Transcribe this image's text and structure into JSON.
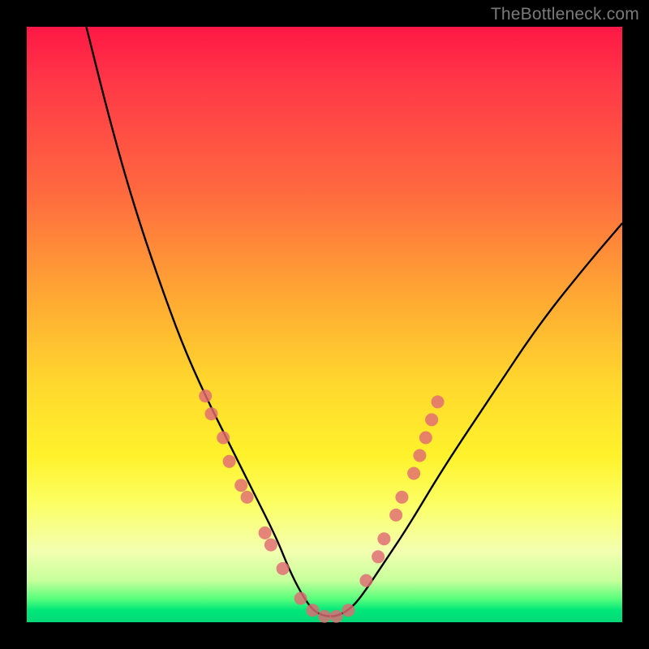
{
  "watermark": "TheBottleneck.com",
  "colors": {
    "frame": "#000000",
    "gradient_top": "#ff1846",
    "gradient_mid": "#ffd82d",
    "gradient_bottom": "#00d977",
    "curve": "#000000",
    "dot": "#e06a74"
  },
  "chart_data": {
    "type": "line",
    "title": "",
    "xlabel": "",
    "ylabel": "",
    "xlim": [
      0,
      100
    ],
    "ylim": [
      0,
      100
    ],
    "grid": false,
    "legend": false,
    "series": [
      {
        "name": "bottleneck-curve",
        "x": [
          10,
          14,
          18,
          22,
          26,
          30,
          34,
          38,
          42,
          44,
          46,
          48,
          50,
          52,
          54,
          56,
          60,
          64,
          70,
          78,
          86,
          94,
          100
        ],
        "y": [
          100,
          84,
          70,
          58,
          47,
          38,
          30,
          22,
          14,
          9,
          5,
          2,
          1,
          1,
          2,
          4,
          10,
          16,
          26,
          38,
          50,
          60,
          67
        ]
      }
    ],
    "markers": [
      {
        "name": "left-cluster",
        "x": 30,
        "y": 38
      },
      {
        "name": "left-cluster",
        "x": 31,
        "y": 35
      },
      {
        "name": "left-cluster",
        "x": 33,
        "y": 31
      },
      {
        "name": "left-cluster",
        "x": 34,
        "y": 27
      },
      {
        "name": "left-cluster",
        "x": 36,
        "y": 23
      },
      {
        "name": "left-cluster",
        "x": 37,
        "y": 21
      },
      {
        "name": "left-cluster",
        "x": 40,
        "y": 15
      },
      {
        "name": "left-cluster",
        "x": 41,
        "y": 13
      },
      {
        "name": "left-cluster",
        "x": 43,
        "y": 9
      },
      {
        "name": "valley",
        "x": 46,
        "y": 4
      },
      {
        "name": "valley",
        "x": 48,
        "y": 2
      },
      {
        "name": "valley",
        "x": 50,
        "y": 1
      },
      {
        "name": "valley",
        "x": 52,
        "y": 1
      },
      {
        "name": "valley",
        "x": 54,
        "y": 2
      },
      {
        "name": "right-cluster",
        "x": 57,
        "y": 7
      },
      {
        "name": "right-cluster",
        "x": 59,
        "y": 11
      },
      {
        "name": "right-cluster",
        "x": 60,
        "y": 14
      },
      {
        "name": "right-cluster",
        "x": 62,
        "y": 18
      },
      {
        "name": "right-cluster",
        "x": 63,
        "y": 21
      },
      {
        "name": "right-cluster",
        "x": 65,
        "y": 25
      },
      {
        "name": "right-cluster",
        "x": 66,
        "y": 28
      },
      {
        "name": "right-cluster",
        "x": 67,
        "y": 31
      },
      {
        "name": "right-cluster",
        "x": 68,
        "y": 34
      },
      {
        "name": "right-cluster",
        "x": 69,
        "y": 37
      }
    ]
  }
}
